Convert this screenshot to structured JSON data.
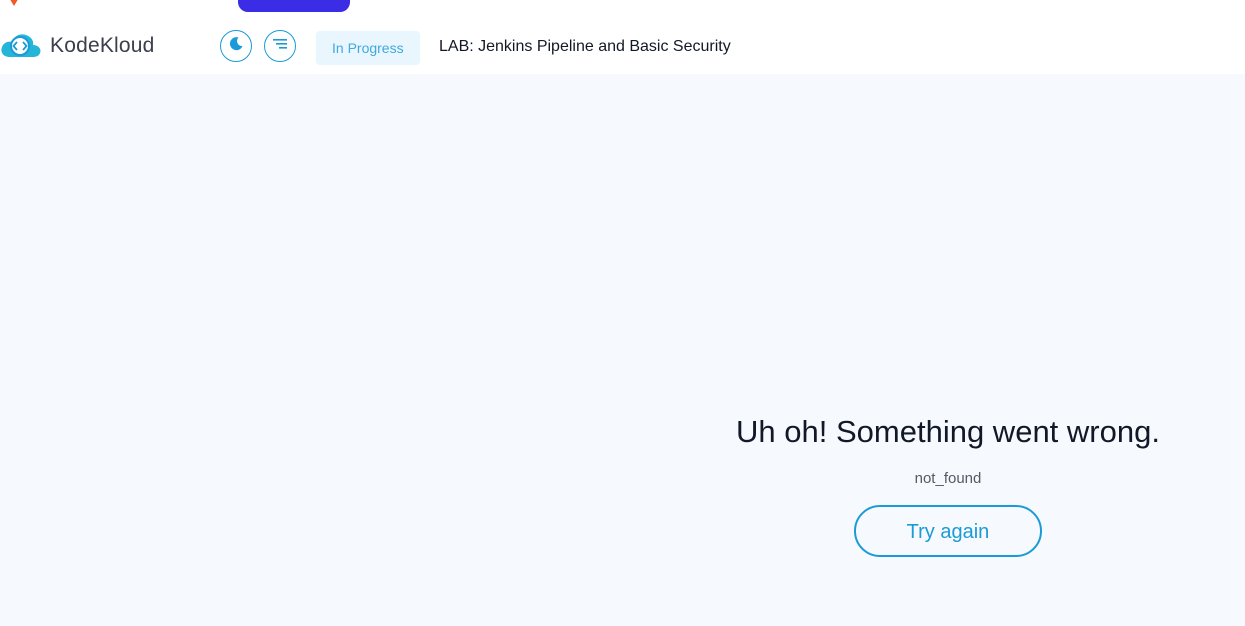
{
  "header": {
    "brand": "KodeKloud",
    "status": "In Progress",
    "lab_title": "LAB: Jenkins Pipeline and Basic Security"
  },
  "error": {
    "title": "Uh oh! Something went wrong.",
    "code": "not_found",
    "retry_label": "Try again"
  },
  "colors": {
    "accent": "#1a9bd8",
    "status_bg": "#eaf6fd",
    "page_bg": "#f6f9fd",
    "tab_accent": "#3b2ce6"
  },
  "icons": {
    "logo": "kodekloud-cloud-icon",
    "theme_toggle": "moon-icon",
    "menu": "menu-lines-icon"
  }
}
